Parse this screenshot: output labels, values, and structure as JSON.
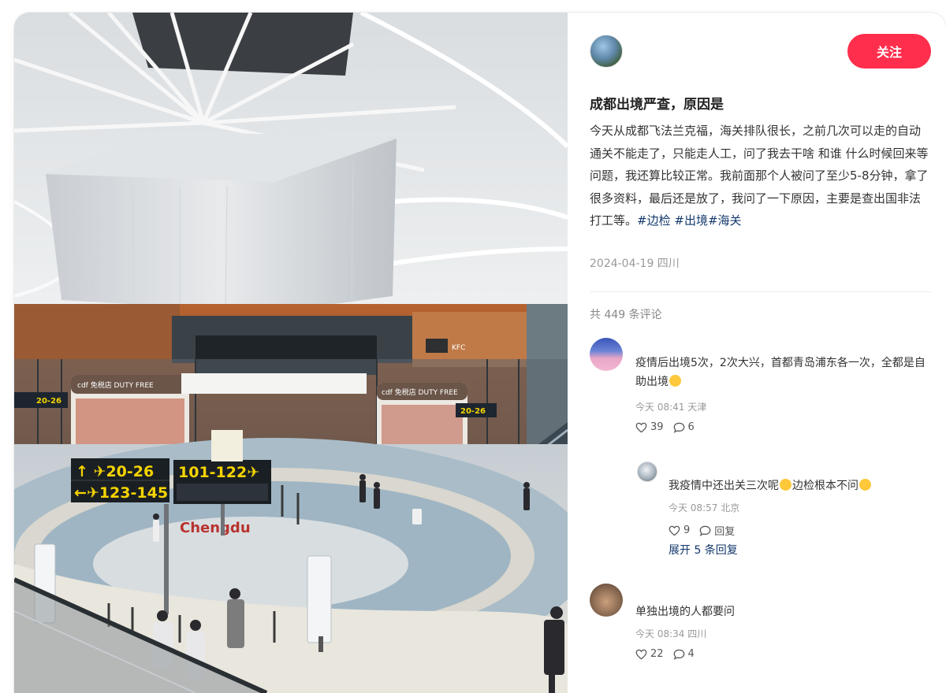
{
  "post": {
    "follow_label": "关注",
    "title": "成都出境严查，原因是",
    "body": "今天从成都飞法兰克福，海关排队很长，之前几次可以走的自动通关不能走了，只能走人工，问了我去干啥 和谁 什么时候回来等问题，我还算比较正常。我前面那个人被问了至少5-8分钟，拿了很多资料，最后还是放了，我问了一下原因，主要是查出国非法打工等。",
    "tags": [
      "#边检",
      "#出境",
      "#海关"
    ],
    "date_location": "2024-04-19 四川"
  },
  "photo": {
    "signs": {
      "left_top": "↑ ✈20-26",
      "left_bottom": "←✈123-145",
      "right_top": "101-122✈",
      "store_left": "cdf 免税店 DUTY FREE",
      "store_right": "cdf 免税店 DUTY FREE",
      "small_left": "20-26",
      "small_right": "20-26",
      "store_kfc": "KFC",
      "floor_text": "Chengdu"
    }
  },
  "comments": {
    "total_label": "共 449 条评论",
    "items": [
      {
        "text": "疫情后出境5次，2次大兴，首都青岛浦东各一次，全都是自助出境",
        "meta": "今天 08:41 天津",
        "likes": "39",
        "replies": "6"
      },
      {
        "text": "单独出境的人都要问",
        "meta": "今天 08:34 四川",
        "likes": "22",
        "replies": "4"
      }
    ],
    "reply": {
      "text_a": "我疫情中还出关三次呢",
      "text_b": "边检根本不问",
      "meta": "今天 08:57 北京",
      "likes": "9",
      "reply_label": "回复"
    },
    "expand_label": "展开 5 条回复"
  },
  "colors": {
    "accent": "#ff2e4d",
    "tag": "#13386c",
    "muted": "#999999"
  }
}
